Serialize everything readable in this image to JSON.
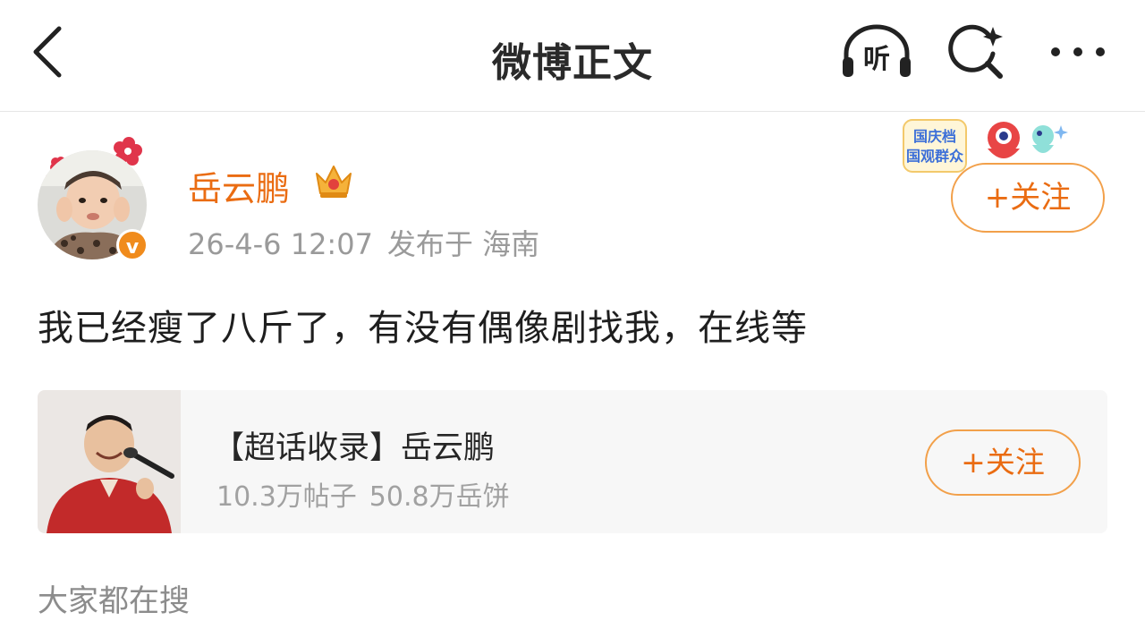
{
  "header": {
    "title": "微博正文",
    "listen_label": "听"
  },
  "author": {
    "name": "岳云鹏",
    "verified_mark": "v",
    "timestamp": "26-4-6 12:07",
    "source": "发布于 海南",
    "follow_label": "+关注",
    "badge_art_text": [
      "国庆档",
      "国观群众"
    ]
  },
  "post": {
    "text": "我已经瘦了八斤了，有没有偶像剧找我，在线等"
  },
  "supertopic_card": {
    "title": "【超话收录】岳云鹏",
    "posts": "10.3万帖子",
    "fans": "50.8万岳饼",
    "follow_label": "+关注"
  },
  "section": {
    "title": "大家都在搜"
  },
  "colors": {
    "accent": "#ea6c12",
    "button_border": "#f2a04a",
    "muted_text": "#9a9a9a",
    "card_bg": "#f7f7f7"
  },
  "icons": [
    "back-chevron-icon",
    "listen-headphones-icon",
    "search-sparkle-icon",
    "more-dots-icon",
    "crown-icon",
    "verified-icon"
  ]
}
